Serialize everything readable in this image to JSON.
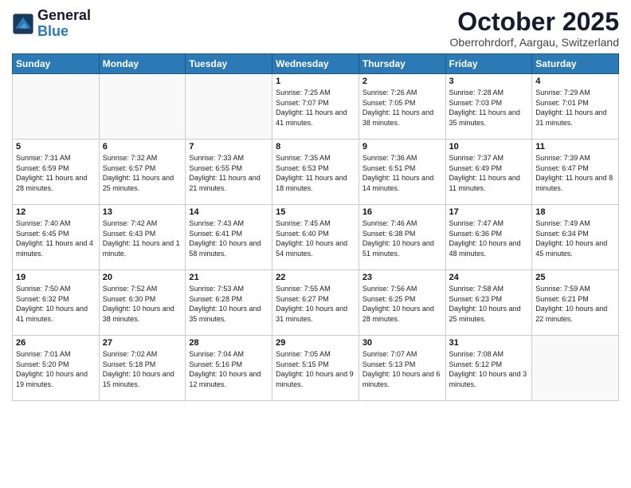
{
  "header": {
    "logo_line1": "General",
    "logo_line2": "Blue",
    "month_title": "October 2025",
    "location": "Oberrohrdorf, Aargau, Switzerland"
  },
  "weekdays": [
    "Sunday",
    "Monday",
    "Tuesday",
    "Wednesday",
    "Thursday",
    "Friday",
    "Saturday"
  ],
  "weeks": [
    [
      {
        "day": "",
        "sunrise": "",
        "sunset": "",
        "daylight": ""
      },
      {
        "day": "",
        "sunrise": "",
        "sunset": "",
        "daylight": ""
      },
      {
        "day": "",
        "sunrise": "",
        "sunset": "",
        "daylight": ""
      },
      {
        "day": "1",
        "sunrise": "Sunrise: 7:25 AM",
        "sunset": "Sunset: 7:07 PM",
        "daylight": "Daylight: 11 hours and 41 minutes."
      },
      {
        "day": "2",
        "sunrise": "Sunrise: 7:26 AM",
        "sunset": "Sunset: 7:05 PM",
        "daylight": "Daylight: 11 hours and 38 minutes."
      },
      {
        "day": "3",
        "sunrise": "Sunrise: 7:28 AM",
        "sunset": "Sunset: 7:03 PM",
        "daylight": "Daylight: 11 hours and 35 minutes."
      },
      {
        "day": "4",
        "sunrise": "Sunrise: 7:29 AM",
        "sunset": "Sunset: 7:01 PM",
        "daylight": "Daylight: 11 hours and 31 minutes."
      }
    ],
    [
      {
        "day": "5",
        "sunrise": "Sunrise: 7:31 AM",
        "sunset": "Sunset: 6:59 PM",
        "daylight": "Daylight: 11 hours and 28 minutes."
      },
      {
        "day": "6",
        "sunrise": "Sunrise: 7:32 AM",
        "sunset": "Sunset: 6:57 PM",
        "daylight": "Daylight: 11 hours and 25 minutes."
      },
      {
        "day": "7",
        "sunrise": "Sunrise: 7:33 AM",
        "sunset": "Sunset: 6:55 PM",
        "daylight": "Daylight: 11 hours and 21 minutes."
      },
      {
        "day": "8",
        "sunrise": "Sunrise: 7:35 AM",
        "sunset": "Sunset: 6:53 PM",
        "daylight": "Daylight: 11 hours and 18 minutes."
      },
      {
        "day": "9",
        "sunrise": "Sunrise: 7:36 AM",
        "sunset": "Sunset: 6:51 PM",
        "daylight": "Daylight: 11 hours and 14 minutes."
      },
      {
        "day": "10",
        "sunrise": "Sunrise: 7:37 AM",
        "sunset": "Sunset: 6:49 PM",
        "daylight": "Daylight: 11 hours and 11 minutes."
      },
      {
        "day": "11",
        "sunrise": "Sunrise: 7:39 AM",
        "sunset": "Sunset: 6:47 PM",
        "daylight": "Daylight: 11 hours and 8 minutes."
      }
    ],
    [
      {
        "day": "12",
        "sunrise": "Sunrise: 7:40 AM",
        "sunset": "Sunset: 6:45 PM",
        "daylight": "Daylight: 11 hours and 4 minutes."
      },
      {
        "day": "13",
        "sunrise": "Sunrise: 7:42 AM",
        "sunset": "Sunset: 6:43 PM",
        "daylight": "Daylight: 11 hours and 1 minute."
      },
      {
        "day": "14",
        "sunrise": "Sunrise: 7:43 AM",
        "sunset": "Sunset: 6:41 PM",
        "daylight": "Daylight: 10 hours and 58 minutes."
      },
      {
        "day": "15",
        "sunrise": "Sunrise: 7:45 AM",
        "sunset": "Sunset: 6:40 PM",
        "daylight": "Daylight: 10 hours and 54 minutes."
      },
      {
        "day": "16",
        "sunrise": "Sunrise: 7:46 AM",
        "sunset": "Sunset: 6:38 PM",
        "daylight": "Daylight: 10 hours and 51 minutes."
      },
      {
        "day": "17",
        "sunrise": "Sunrise: 7:47 AM",
        "sunset": "Sunset: 6:36 PM",
        "daylight": "Daylight: 10 hours and 48 minutes."
      },
      {
        "day": "18",
        "sunrise": "Sunrise: 7:49 AM",
        "sunset": "Sunset: 6:34 PM",
        "daylight": "Daylight: 10 hours and 45 minutes."
      }
    ],
    [
      {
        "day": "19",
        "sunrise": "Sunrise: 7:50 AM",
        "sunset": "Sunset: 6:32 PM",
        "daylight": "Daylight: 10 hours and 41 minutes."
      },
      {
        "day": "20",
        "sunrise": "Sunrise: 7:52 AM",
        "sunset": "Sunset: 6:30 PM",
        "daylight": "Daylight: 10 hours and 38 minutes."
      },
      {
        "day": "21",
        "sunrise": "Sunrise: 7:53 AM",
        "sunset": "Sunset: 6:28 PM",
        "daylight": "Daylight: 10 hours and 35 minutes."
      },
      {
        "day": "22",
        "sunrise": "Sunrise: 7:55 AM",
        "sunset": "Sunset: 6:27 PM",
        "daylight": "Daylight: 10 hours and 31 minutes."
      },
      {
        "day": "23",
        "sunrise": "Sunrise: 7:56 AM",
        "sunset": "Sunset: 6:25 PM",
        "daylight": "Daylight: 10 hours and 28 minutes."
      },
      {
        "day": "24",
        "sunrise": "Sunrise: 7:58 AM",
        "sunset": "Sunset: 6:23 PM",
        "daylight": "Daylight: 10 hours and 25 minutes."
      },
      {
        "day": "25",
        "sunrise": "Sunrise: 7:59 AM",
        "sunset": "Sunset: 6:21 PM",
        "daylight": "Daylight: 10 hours and 22 minutes."
      }
    ],
    [
      {
        "day": "26",
        "sunrise": "Sunrise: 7:01 AM",
        "sunset": "Sunset: 5:20 PM",
        "daylight": "Daylight: 10 hours and 19 minutes."
      },
      {
        "day": "27",
        "sunrise": "Sunrise: 7:02 AM",
        "sunset": "Sunset: 5:18 PM",
        "daylight": "Daylight: 10 hours and 15 minutes."
      },
      {
        "day": "28",
        "sunrise": "Sunrise: 7:04 AM",
        "sunset": "Sunset: 5:16 PM",
        "daylight": "Daylight: 10 hours and 12 minutes."
      },
      {
        "day": "29",
        "sunrise": "Sunrise: 7:05 AM",
        "sunset": "Sunset: 5:15 PM",
        "daylight": "Daylight: 10 hours and 9 minutes."
      },
      {
        "day": "30",
        "sunrise": "Sunrise: 7:07 AM",
        "sunset": "Sunset: 5:13 PM",
        "daylight": "Daylight: 10 hours and 6 minutes."
      },
      {
        "day": "31",
        "sunrise": "Sunrise: 7:08 AM",
        "sunset": "Sunset: 5:12 PM",
        "daylight": "Daylight: 10 hours and 3 minutes."
      },
      {
        "day": "",
        "sunrise": "",
        "sunset": "",
        "daylight": ""
      }
    ]
  ]
}
